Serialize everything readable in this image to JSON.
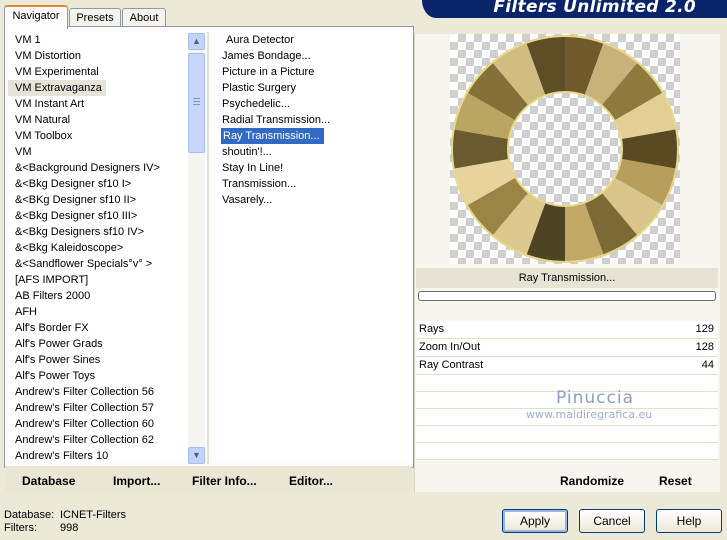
{
  "banner": {
    "title": "Filters Unlimited 2.0"
  },
  "tabs": [
    {
      "label": "Navigator",
      "active": true
    },
    {
      "label": "Presets",
      "active": false
    },
    {
      "label": "About",
      "active": false
    }
  ],
  "categories": [
    "VM 1",
    "VM Distortion",
    "VM Experimental",
    "VM Extravaganza",
    "VM Instant Art",
    "VM Natural",
    "VM Toolbox",
    "VM",
    "&<Background Designers IV>",
    "&<Bkg Designer sf10 I>",
    "&<BKg Designer sf10 II>",
    "&<Bkg Designer sf10 III>",
    "&<Bkg Designers sf10 IV>",
    "&<Bkg Kaleidoscope>",
    "&<Sandflower Specials°v° >",
    "[AFS IMPORT]",
    "AB Filters 2000",
    "AFH",
    "Alf's Border FX",
    "Alf's Power Grads",
    "Alf's Power Sines",
    "Alf's Power Toys",
    "Andrew's Filter Collection 56",
    "Andrew's Filter Collection 57",
    "Andrew's Filter Collection 60",
    "Andrew's Filter Collection 62",
    "Andrew's Filters 10"
  ],
  "selected_category": "VM Extravaganza",
  "filters": [
    "Aura Detector",
    "James Bondage...",
    "Picture in a Picture",
    "Plastic Surgery",
    "Psychedelic...",
    "Radial Transmission...",
    "Ray Transmission...",
    "shoutin'!...",
    "Stay In Line!",
    "Transmission...",
    "Vasarely..."
  ],
  "selected_filter": "Ray Transmission...",
  "left_buttons": {
    "database": "Database",
    "import": "Import...",
    "filter_info": "Filter Info...",
    "editor": "Editor..."
  },
  "preview": {
    "filter_name": "Ray Transmission..."
  },
  "params": [
    {
      "label": "Rays",
      "value": "129"
    },
    {
      "label": "Zoom In/Out",
      "value": "128"
    },
    {
      "label": "Ray Contrast",
      "value": "44"
    }
  ],
  "watermark": {
    "line1": "Pinuccia",
    "line2": "www.maidiregrafica.eu"
  },
  "right_buttons": {
    "randomize": "Randomize",
    "reset": "Reset"
  },
  "footer": {
    "database_label": "Database:",
    "database_value": "ICNET-Filters",
    "filters_label": "Filters:",
    "filters_value": "998",
    "apply": "Apply",
    "cancel": "Cancel",
    "help": "Help"
  },
  "colors": {
    "selection": "#316ac5",
    "banner": "#0a246a",
    "tab_highlight": "#e68b2c"
  }
}
